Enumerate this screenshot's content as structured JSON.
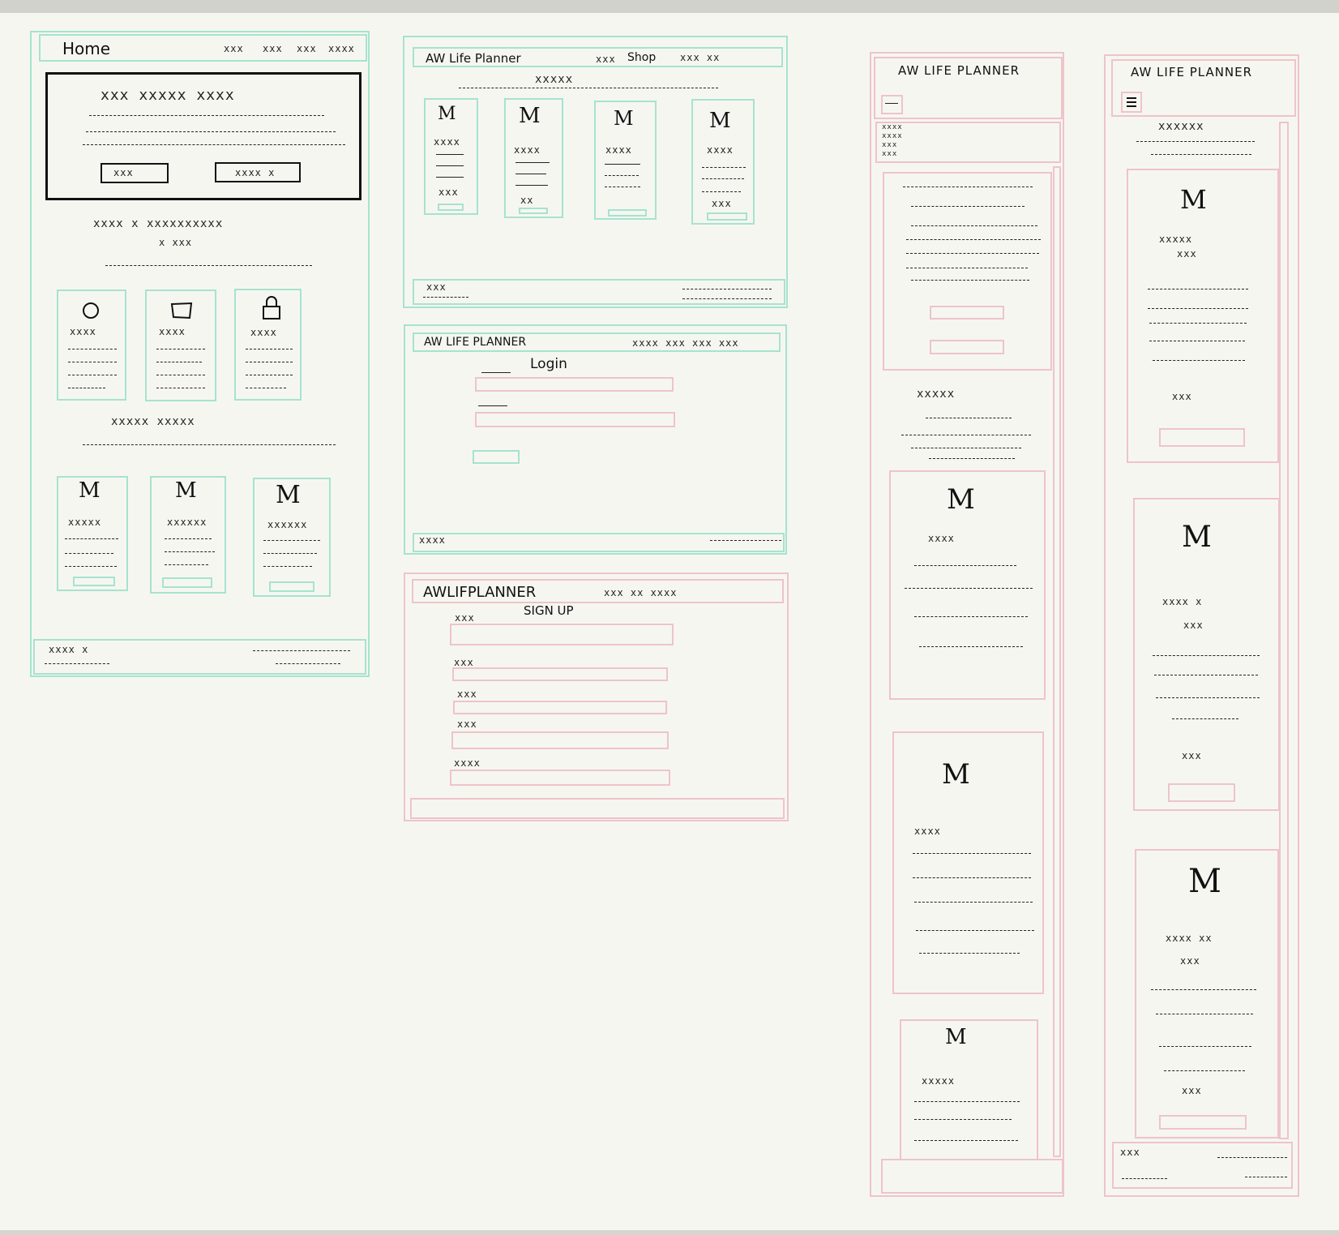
{
  "colors": {
    "desktop_frame": "#a6e3cf",
    "mobile_frame": "#eec4c8",
    "ink": "#111111",
    "paper": "#f6f6f1"
  },
  "home": {
    "nav_title": "Home",
    "nav_links": [
      "xxx",
      "xxx",
      "xxx",
      "xxxx"
    ],
    "hero_heading": "xxx xxxxx xxxx",
    "hero_btn_1": "xxx",
    "hero_btn_2": "xxxx x",
    "section_1_heading": "xxxx x xxxxxxxxxx",
    "section_1_sub": "x xxx",
    "features": [
      {
        "icon": "circle-icon",
        "title": "xxxx"
      },
      {
        "icon": "box-icon",
        "title": "xxxx"
      },
      {
        "icon": "lock-icon",
        "title": "xxxx"
      }
    ],
    "section_2_heading": "xxxxx xxxxx",
    "cards": [
      "xxxxx",
      "xxxxxx",
      "xxxxxx"
    ],
    "footer_left": "xxxx x"
  },
  "shop": {
    "brand": "AW Life Planner",
    "nav_prefix": "xxx",
    "nav_shop": "Shop",
    "nav_rest": "xxx xx",
    "heading": "xxxxx",
    "products": [
      "xxxx",
      "xxxx",
      "xxxx",
      "xxxx"
    ],
    "product_prices": [
      "xxx",
      "xx",
      "xxx",
      "xxx"
    ],
    "footer_left": "xxx"
  },
  "login": {
    "brand": "AW LIFE PLANNER",
    "nav": "xxxx xxx xxx xxx",
    "title": "Login",
    "footer_left": "xxxx"
  },
  "signup": {
    "brand": "AWLIFPLANNER",
    "nav": "xxx xx xxxx",
    "title": "SIGN UP",
    "labels": [
      "xxx",
      "xxx",
      "xxx",
      "xxx",
      "xxxx"
    ]
  },
  "mobile_1": {
    "brand": "AW LIFE PLANNER",
    "menu_items": [
      "xxxx",
      "xxxx",
      "xxx",
      "xxx"
    ],
    "heading": "xxxxx",
    "cards": [
      "xxxx",
      "xxxx",
      "xxxxx"
    ]
  },
  "mobile_2": {
    "brand": "AW LIFE PLANNER",
    "heading": "xxxxxx",
    "cards": [
      {
        "title": "xxxxx",
        "sub": "xxx",
        "price": "xxx"
      },
      {
        "title": "xxxx x",
        "sub": "xxx",
        "price": "xxx"
      },
      {
        "title": "xxxx xx",
        "sub": "xxx",
        "price": "xxx"
      }
    ],
    "footer_left": "xxx"
  }
}
